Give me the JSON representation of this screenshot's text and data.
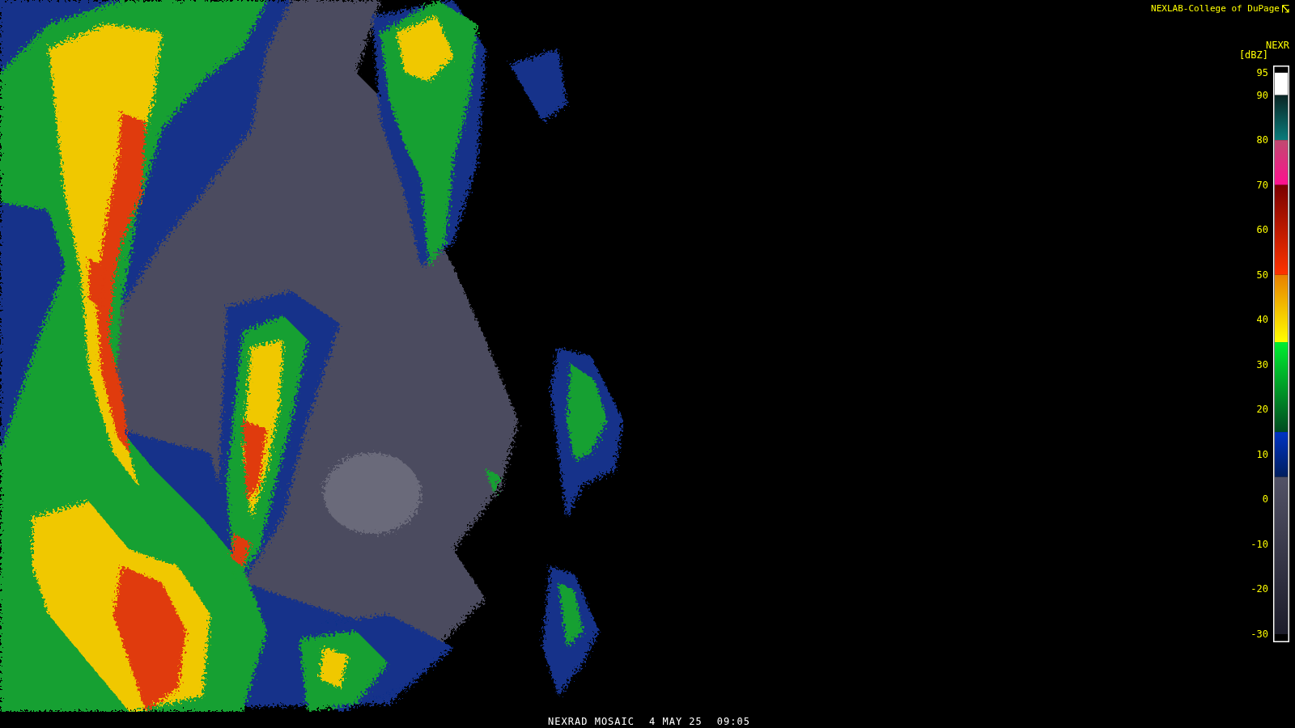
{
  "credit": {
    "text": "NEXLAB-College of DuPage"
  },
  "legend": {
    "product": "NEXR",
    "unit": "[dBZ]",
    "ticks": [
      "95",
      "90",
      "80",
      "70",
      "60",
      "50",
      "40",
      "30",
      "20",
      "10",
      "0",
      "-10",
      "-20",
      "-30"
    ]
  },
  "caption": {
    "product": "NEXRAD MOSAIC",
    "date": "4 MAY 25",
    "time": "09:05"
  }
}
